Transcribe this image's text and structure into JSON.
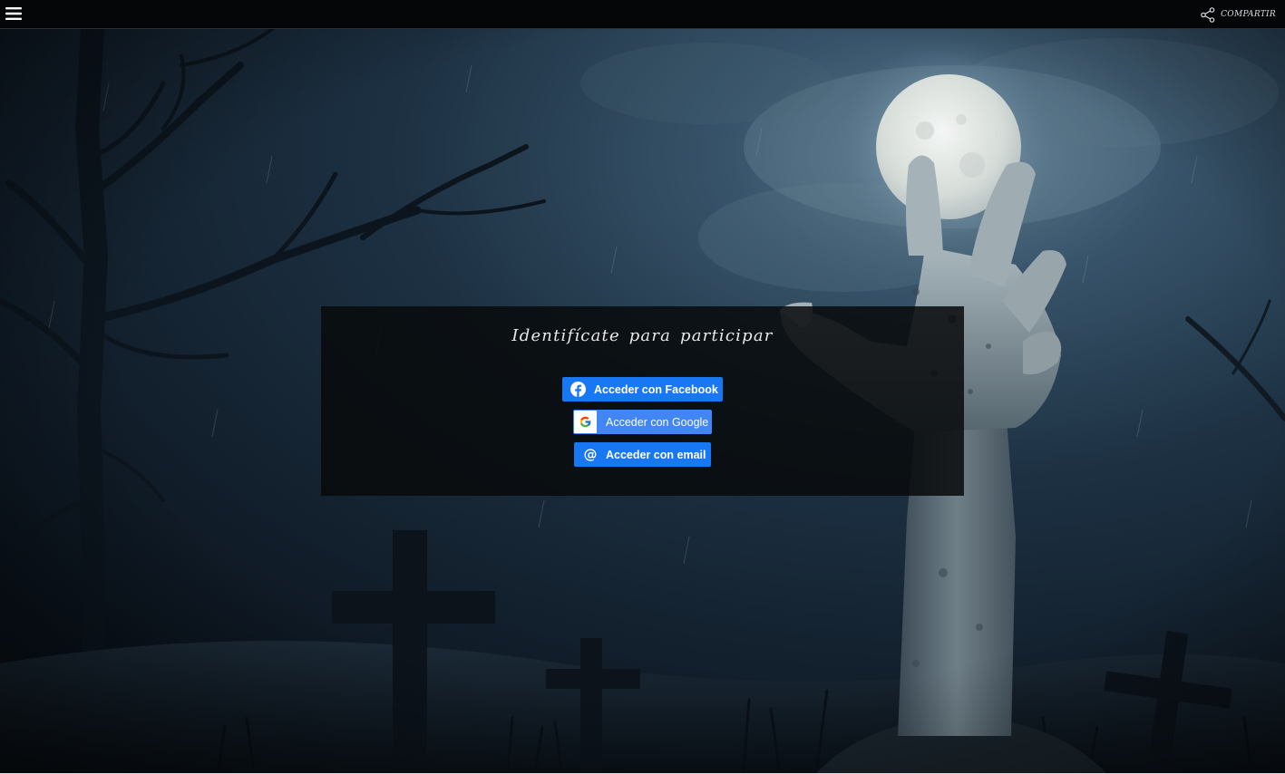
{
  "topbar": {
    "share_label": "COMPARTIR"
  },
  "login": {
    "title": "Identifícate para participar",
    "facebook_label": "Acceder con Facebook",
    "google_label": "Acceder con Google",
    "email_label": "Acceder con email"
  },
  "colors": {
    "facebook_blue": "#1877f2",
    "google_blue": "#4285f4",
    "topbar_bg": "#050607"
  },
  "icons": {
    "menu": "hamburger-icon",
    "share": "share-icon",
    "facebook": "facebook-icon",
    "google": "google-icon",
    "email": "at-sign-icon"
  }
}
